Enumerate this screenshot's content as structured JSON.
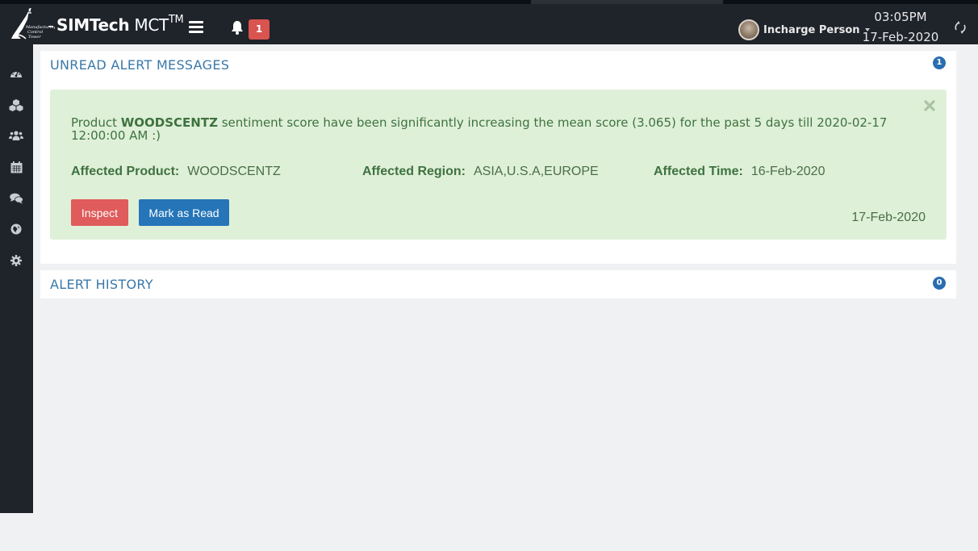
{
  "header": {
    "brand_name": "SIMTech",
    "brand_product": "MCT",
    "brand_trademark": "TM",
    "logo_alt": "Manufacturing Control Tower",
    "notification_count": "1",
    "user_name": "Incharge Person",
    "time": "03:05PM",
    "date": "17-Feb-2020"
  },
  "sidebar": {
    "items": [
      {
        "icon": "dashboard-icon"
      },
      {
        "icon": "cubes-icon"
      },
      {
        "icon": "users-icon"
      },
      {
        "icon": "calendar-icon"
      },
      {
        "icon": "comments-icon"
      },
      {
        "icon": "globe-icon"
      },
      {
        "icon": "gear-icon"
      }
    ]
  },
  "unread": {
    "title": "UNREAD ALERT MESSAGES",
    "count": "1",
    "alerts": [
      {
        "message_prefix": "Product ",
        "message_product": "WOODSCENTZ",
        "message_suffix": " sentiment score have been significantly increasing the mean score (3.065) for the past 5 days till 2020-02-17 12:00:00 AM :)",
        "product_label": "Affected Product:",
        "product_value": "WOODSCENTZ",
        "region_label": "Affected Region:",
        "region_value": "ASIA,U.S.A,EUROPE",
        "time_label": "Affected Time:",
        "time_value": "16-Feb-2020",
        "inspect_label": "Inspect",
        "mark_read_label": "Mark as Read",
        "date": "17-Feb-2020"
      }
    ]
  },
  "history": {
    "title": "ALERT HISTORY",
    "count": "0"
  },
  "colors": {
    "navbar": "#1f232a",
    "panel_title": "#3a78a8",
    "alert_bg": "#dff0d8",
    "alert_text": "#3c763d",
    "danger": "#e05b5b",
    "primary": "#2575b8",
    "badge": "#2a6db0",
    "notif_badge": "#d9534f"
  }
}
